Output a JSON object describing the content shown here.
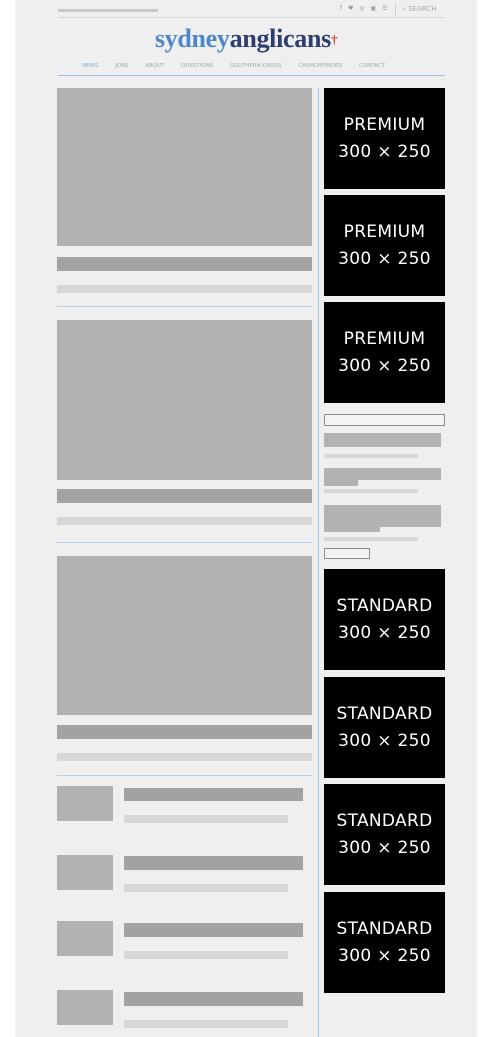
{
  "header": {
    "social_icons_glyph": "f ♥ ◎ ▣ ☰",
    "social_icons": [
      "facebook-icon",
      "twitter-icon",
      "instagram-icon",
      "youtube-icon",
      "rss-icon"
    ],
    "search_label": "SEARCH",
    "logo_part1": "sydney",
    "logo_part2": "anglicans",
    "logo_cross": "†"
  },
  "nav": {
    "items": [
      "NEWS",
      "JOBS",
      "ABOUT",
      "QUESTIONS",
      "SOUTHERN CROSS",
      "CHURCHFINDER",
      "CONTACT"
    ]
  },
  "sidebar": {
    "premium_ads": [
      {
        "label": "PREMIUM",
        "size": "300 × 250"
      },
      {
        "label": "PREMIUM",
        "size": "300 × 250"
      },
      {
        "label": "PREMIUM",
        "size": "300 × 250"
      }
    ],
    "standard_ads": [
      {
        "label": "STANDARD",
        "size": "300 × 250"
      },
      {
        "label": "STANDARD",
        "size": "300 × 250"
      },
      {
        "label": "STANDARD",
        "size": "300 × 250"
      },
      {
        "label": "STANDARD",
        "size": "300 × 250"
      }
    ]
  },
  "colors": {
    "logo_light": "#4f88c9",
    "logo_dark": "#2f3e72",
    "cross": "#d8402f",
    "divider": "#a3c6ea",
    "ad_background": "#000000"
  }
}
